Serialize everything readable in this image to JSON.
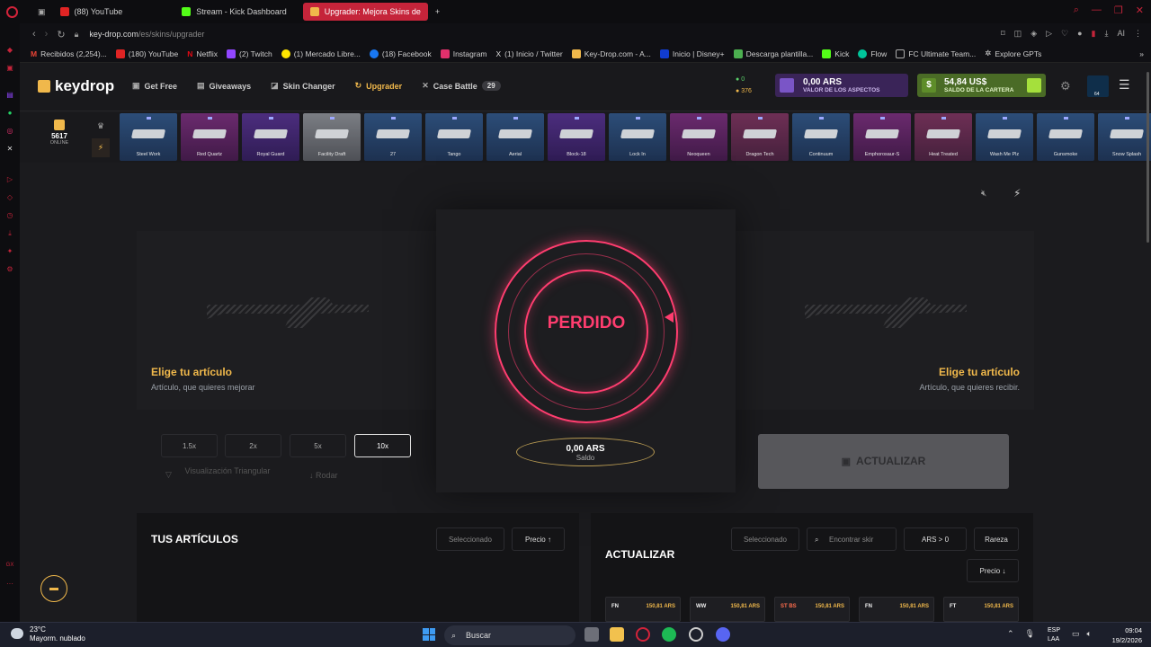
{
  "browser": {
    "tabs": [
      {
        "label": "(88) YouTube",
        "color": "#e02424"
      },
      {
        "label": "Stream - Kick Dashboard",
        "color": "#53fc18"
      },
      {
        "label": "Upgrader: Mejora Skins de",
        "color": "#f0b84b"
      }
    ],
    "new_tab": "+",
    "url_host": "key-drop.com",
    "url_path": "/es/skins/upgrader",
    "ai_label": "AI",
    "bookmarks": [
      "Recibidos (2,254)...",
      "(180) YouTube",
      "Netflix",
      "(2) Twitch",
      "(1) Mercado Libre...",
      "(18) Facebook",
      "Instagram",
      "(1) Inicio / Twitter",
      "Key-Drop.com - A...",
      "Inicio | Disney+",
      "Descarga plantilla...",
      "Kick",
      "Flow",
      "FC Ultimate Team...",
      "Explore GPTs"
    ]
  },
  "site": {
    "logo": "keydrop",
    "menu": [
      "Get Free",
      "Giveaways",
      "Skin Changer",
      "Upgrader",
      "Case Battle"
    ],
    "case_battle_count": "29",
    "coins_green": "0",
    "coins_gold": "376",
    "skins_value": "0,00 ARS",
    "skins_value_label": "VALOR DE LOS ASPECTOS",
    "wallet_value": "54,84 US$",
    "wallet_label": "SALDO DE LA CARTERA",
    "avatar_level": "64",
    "online_count": "5617",
    "online_label": "ONLINE"
  },
  "drops": [
    {
      "name": "Steel Work",
      "rarity": "blue"
    },
    {
      "name": "Red Quartz",
      "rarity": "pink"
    },
    {
      "name": "Royal Guard",
      "rarity": "purple"
    },
    {
      "name": "Facility Draft",
      "rarity": "gray"
    },
    {
      "name": "27",
      "rarity": "blue"
    },
    {
      "name": "Tango",
      "rarity": "blue"
    },
    {
      "name": "Aerial",
      "rarity": "blue"
    },
    {
      "name": "Block-18",
      "rarity": "purple"
    },
    {
      "name": "Lock In",
      "rarity": "blue"
    },
    {
      "name": "Neoqueen",
      "rarity": "pink"
    },
    {
      "name": "Dragon Tech",
      "rarity": "red"
    },
    {
      "name": "Continuum",
      "rarity": "blue"
    },
    {
      "name": "Emphorosaur-S",
      "rarity": "pink"
    },
    {
      "name": "Heat Treated",
      "rarity": "red"
    },
    {
      "name": "Wash Me Plz",
      "rarity": "blue"
    },
    {
      "name": "Gunsmoke",
      "rarity": "blue"
    },
    {
      "name": "Snow Splash",
      "rarity": "blue"
    }
  ],
  "upgrader": {
    "left_title": "Elige tu artículo",
    "left_sub": "Artículo, que quieres mejorar",
    "right_title": "Elige tu artículo",
    "right_sub": "Artículo, que quieres recibir.",
    "result": "PERDIDO",
    "balance_value": "0,00 ARS",
    "balance_label": "Saldo",
    "multipliers": [
      "1.5x",
      "2x",
      "5x",
      "10x"
    ],
    "selected_multiplier": "10x",
    "triangular": "Visualización Triangular",
    "rodar": "↓ Rodar",
    "actualizar_button": "ACTUALIZAR"
  },
  "your_items": {
    "title": "TUS ARTÍCULOS",
    "selected": "Seleccionado",
    "sort": "Precio ↑"
  },
  "upgrade_items": {
    "title": "ACTUALIZAR",
    "selected": "Seleccionado",
    "search_placeholder": "Encontrar skir",
    "filter_prefix": "ARS >",
    "filter_value": "0",
    "rarity": "Rareza",
    "sort": "Precio ↓",
    "cards": [
      {
        "wear": "FN",
        "price": "150,81 ARS"
      },
      {
        "wear": "WW",
        "price": "150,81 ARS"
      },
      {
        "wear": "ST BS",
        "price": "150,81 ARS"
      },
      {
        "wear": "FN",
        "price": "150,81 ARS"
      },
      {
        "wear": "FT",
        "price": "150,81 ARS"
      }
    ]
  },
  "taskbar": {
    "temp": "23°C",
    "weather": "Mayorm. nublado",
    "search": "Buscar",
    "lang1": "ESP",
    "lang2": "LAA",
    "time": "09:04",
    "date": "19/2/2026"
  },
  "colors": {
    "accent": "#f0b84b",
    "lost": "#ff3d6f",
    "opera": "#c5243a"
  }
}
